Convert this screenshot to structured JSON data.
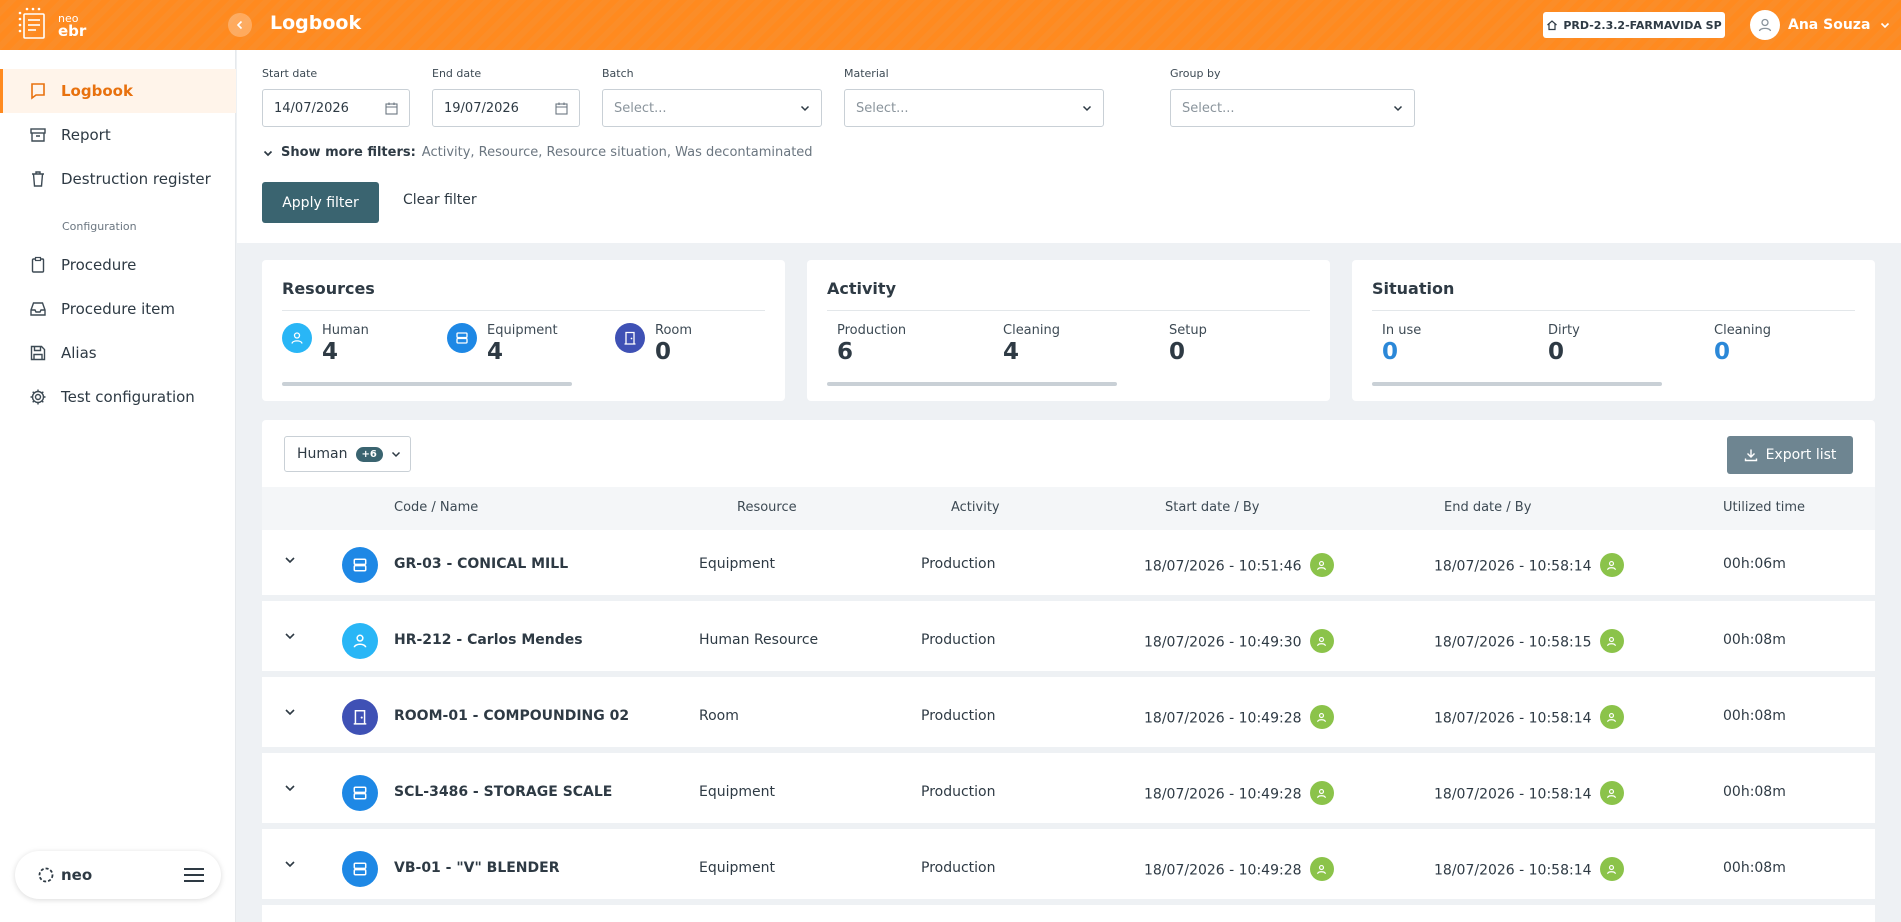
{
  "app": {
    "logo_small": "neo",
    "logo_big": "ebr"
  },
  "header": {
    "title": "Logbook",
    "environment": "PRD-2.3.2-FARMAVIDA SP",
    "user_name": "Ana Souza"
  },
  "sidebar": {
    "items": [
      {
        "label": "Logbook",
        "icon": "book-icon",
        "active": true
      },
      {
        "label": "Report",
        "icon": "archive-icon"
      },
      {
        "label": "Destruction register",
        "icon": "trash-icon"
      }
    ],
    "section_label": "Configuration",
    "config_items": [
      {
        "label": "Procedure",
        "icon": "clipboard-icon"
      },
      {
        "label": "Procedure item",
        "icon": "inbox-icon"
      },
      {
        "label": "Alias",
        "icon": "save-icon"
      },
      {
        "label": "Test configuration",
        "icon": "gear-icon"
      }
    ],
    "footer_brand": "neo"
  },
  "filters": {
    "start_date": {
      "label": "Start date",
      "value": "14/07/2026"
    },
    "end_date": {
      "label": "End date",
      "value": "19/07/2026"
    },
    "batch": {
      "label": "Batch",
      "placeholder": "Select..."
    },
    "material": {
      "label": "Material",
      "placeholder": "Select..."
    },
    "group_by": {
      "label": "Group by",
      "placeholder": "Select..."
    },
    "more_filters_label": "Show more filters:",
    "more_filters_list": "Activity, Resource, Resource situation, Was decontaminated",
    "apply_label": "Apply filter",
    "clear_label": "Clear filter"
  },
  "summary": {
    "resources": {
      "title": "Resources",
      "stats": [
        {
          "label": "Human",
          "value": "4",
          "icon": "user-icon",
          "color": "#29b6f6"
        },
        {
          "label": "Equipment",
          "value": "4",
          "icon": "server-icon",
          "color": "#1e88e5"
        },
        {
          "label": "Room",
          "value": "0",
          "icon": "door-icon",
          "color": "#3f51b5"
        }
      ]
    },
    "activity": {
      "title": "Activity",
      "stats": [
        {
          "label": "Production",
          "value": "6"
        },
        {
          "label": "Cleaning",
          "value": "4"
        },
        {
          "label": "Setup",
          "value": "0"
        }
      ]
    },
    "situation": {
      "title": "Situation",
      "stats": [
        {
          "label": "In use",
          "value": "0",
          "color": "#2b88d8"
        },
        {
          "label": "Dirty",
          "value": "0"
        },
        {
          "label": "Cleaning",
          "value": "0",
          "color": "#2b88d8"
        }
      ]
    }
  },
  "table": {
    "resource_filter": {
      "value": "Human",
      "extra_count": "+6"
    },
    "export_label": "Export list",
    "columns": [
      "Code / Name",
      "Resource",
      "Activity",
      "Start date / By",
      "End date / By",
      "Utilized time"
    ],
    "rows": [
      {
        "code": "GR-03 - CONICAL MILL",
        "resource": "Equipment",
        "activity": "Production",
        "start": "18/07/2026 - 10:51:46",
        "end": "18/07/2026 - 10:58:14",
        "time": "00h:06m",
        "icon": "server-icon",
        "color": "#1e88e5"
      },
      {
        "code": "HR-212 - Carlos Mendes",
        "resource": "Human Resource",
        "activity": "Production",
        "start": "18/07/2026 - 10:49:30",
        "end": "18/07/2026 - 10:58:15",
        "time": "00h:08m",
        "icon": "user-icon",
        "color": "#29b6f6"
      },
      {
        "code": "ROOM-01 - COMPOUNDING 02",
        "resource": "Room",
        "activity": "Production",
        "start": "18/07/2026 - 10:49:28",
        "end": "18/07/2026 - 10:58:14",
        "time": "00h:08m",
        "icon": "door-icon",
        "color": "#3f51b5"
      },
      {
        "code": "SCL-3486 - STORAGE SCALE",
        "resource": "Equipment",
        "activity": "Production",
        "start": "18/07/2026 - 10:49:28",
        "end": "18/07/2026 - 10:58:14",
        "time": "00h:08m",
        "icon": "server-icon",
        "color": "#1e88e5"
      },
      {
        "code": "VB-01 - \"V\" BLENDER",
        "resource": "Equipment",
        "activity": "Production",
        "start": "18/07/2026 - 10:49:28",
        "end": "18/07/2026 - 10:58:14",
        "time": "00h:08m",
        "icon": "server-icon",
        "color": "#1e88e5"
      }
    ]
  },
  "colors": {
    "brand": "#ff8a1f",
    "primary_button": "#3a6470",
    "user_ok": "#8bc34a"
  }
}
